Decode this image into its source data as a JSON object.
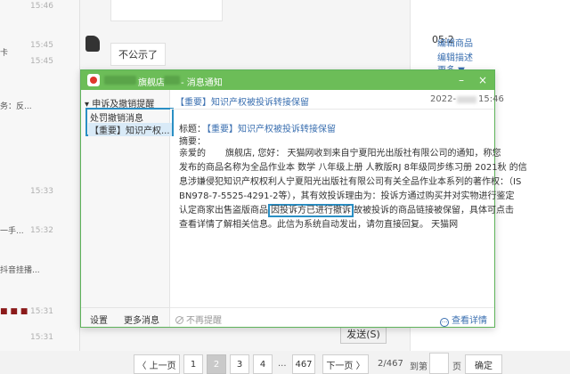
{
  "background": {
    "left_fragments": [
      "卡",
      "务：反...",
      "一手...",
      "抖音挂播..."
    ],
    "times": [
      "15:46",
      "15:45",
      "15:45",
      "15:33",
      "15:32",
      "15:31",
      "15:31"
    ],
    "chat_bubble": "不公示了",
    "right_time": "05:2",
    "right_links": [
      "编辑商品",
      "编辑描述",
      "更多 ▼"
    ],
    "send_button": "发送(S)"
  },
  "window": {
    "title_shop": "旗舰店",
    "title_suffix": "- 消息通知",
    "controls": [
      "–",
      "×"
    ],
    "sidebar": {
      "group": "申诉及撤销提醒",
      "items": [
        "处罚撤销消息",
        "【重要】知识产权..."
      ],
      "footer": [
        "设置",
        "更多消息"
      ]
    },
    "message": {
      "header_title": "【重要】知识产权被投诉转接保留",
      "date_prefix": "2022-",
      "time": "15:46",
      "subject_label": "标题：",
      "subject": "【重要】知识产权被投诉转接保留",
      "summary_label": "摘要：",
      "body_lines": [
        [
          "亲爱的",
          "旗舰店, 您好：  天猫网收到来自宁夏阳光出版社有限公司的通知，称您"
        ],
        [
          "发布的商品名称为全品作业本 数学 八年级上册 人教版RJ 8年级同步练习册 2021秋 的信"
        ],
        [
          "息涉嫌侵犯知识产权权利人宁夏阳光出版社有限公司有关全品作业本系列的著作权：（IS"
        ],
        [
          "BN978-7-5525-4291-2等），其有效投诉理由为：投诉方通过购买并对实物进行鉴定"
        ],
        [
          "认定商家出售盗版商品",
          "因投诉方已进行撤诉",
          "故被投诉的商品链接被保留，具体可点击"
        ],
        [
          "查看详情了解相关信息。此信为系统自动发出，请勿直接回复。  天猫网"
        ]
      ]
    },
    "footer": {
      "no_remind": "不再提醒",
      "view_detail": "查看详情"
    }
  },
  "pager": {
    "prev": "〈 上一页",
    "pages": [
      "1",
      "2",
      "3",
      "4",
      "...",
      "467"
    ],
    "next": "下一页 〉",
    "status": "2/467",
    "goto_label": "到第",
    "page_unit": "页",
    "confirm": "确定"
  },
  "colors": {
    "titlebar_green": "#6cbd58",
    "highlight_box": "#2a8fc4",
    "link_blue": "#3a6fb0"
  }
}
